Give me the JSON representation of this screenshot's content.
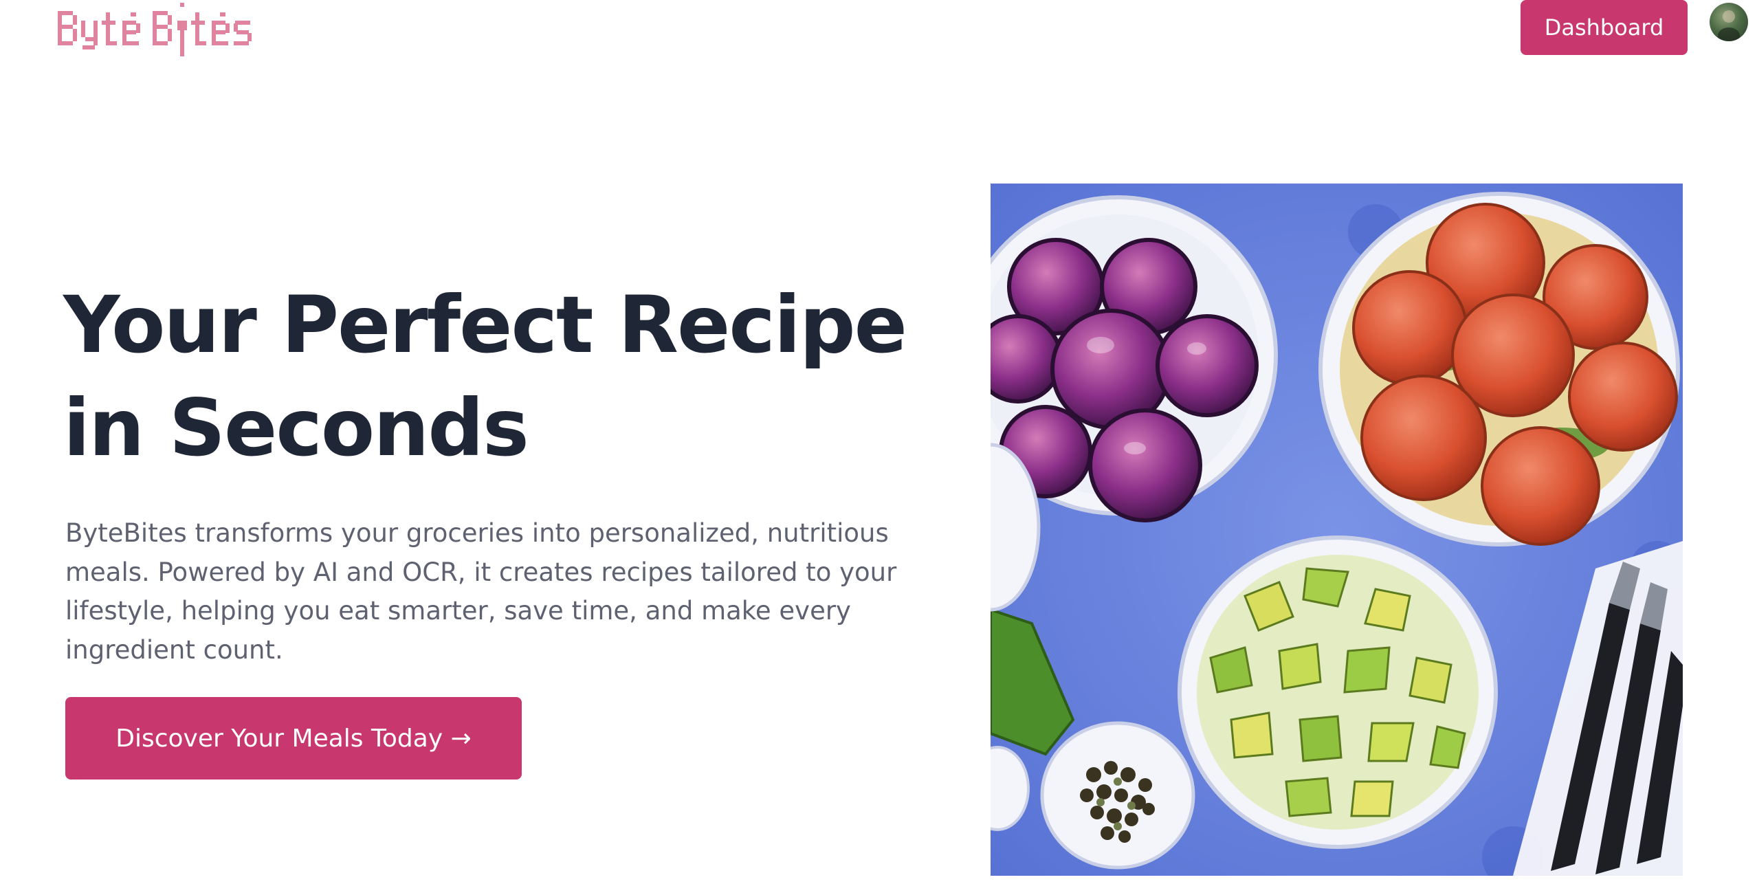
{
  "header": {
    "logo_text": "ByteBites",
    "dashboard_label": "Dashboard"
  },
  "hero": {
    "title_line1": "Your Perfect Recipe",
    "title_line2": "in Seconds",
    "description": "ByteBites transforms your groceries into personalized, nutritious meals. Powered by AI and OCR, it creates recipes tailored to your lifestyle, helping you eat smarter, save time, and make every ingredient count.",
    "cta_label": "Discover Your Meals Today →"
  },
  "colors": {
    "brand": "#c8386e",
    "logo": "#e0839f",
    "heading": "#1f2636",
    "body_text": "#5e6270",
    "illustration_background": "#6b85dd"
  },
  "icons": {
    "avatar": "user-avatar-photo",
    "logo_spoon": "spoon-icon"
  }
}
